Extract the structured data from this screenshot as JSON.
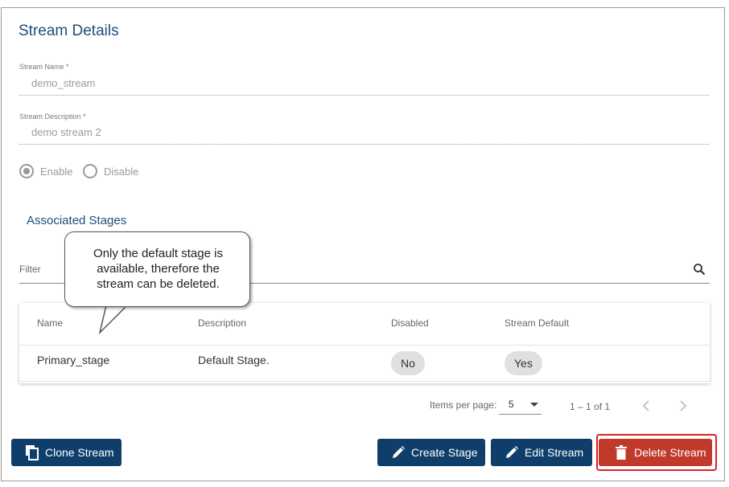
{
  "header": {
    "title": "Stream Details"
  },
  "fields": {
    "name": {
      "label": "Stream Name *",
      "value": "demo_stream"
    },
    "description": {
      "label": "Stream Description *",
      "value": "demo stream 2"
    }
  },
  "status": {
    "options": [
      {
        "label": "Enable",
        "selected": true
      },
      {
        "label": "Disable",
        "selected": false
      }
    ]
  },
  "stages": {
    "title": "Associated Stages",
    "filter_placeholder": "Filter",
    "columns": [
      "Name",
      "Description",
      "Disabled",
      "Stream Default"
    ],
    "rows": [
      {
        "name": "Primary_stage",
        "description": "Default Stage.",
        "disabled": "No",
        "stream_default": "Yes"
      }
    ]
  },
  "pager": {
    "items_per_page_label": "Items per page:",
    "items_per_page_value": "5",
    "range": "1 – 1 of 1"
  },
  "actions": {
    "clone": "Clone Stream",
    "create_stage": "Create Stage",
    "edit": "Edit Stream",
    "delete": "Delete Stream"
  },
  "callout": {
    "lines": [
      "Only the default stage is",
      "available, therefore the",
      "stream can be deleted."
    ]
  },
  "colors": {
    "primary": "#0f3e6b",
    "danger": "#c0392b",
    "title": "#1f4e79",
    "highlight": "#e02020"
  }
}
